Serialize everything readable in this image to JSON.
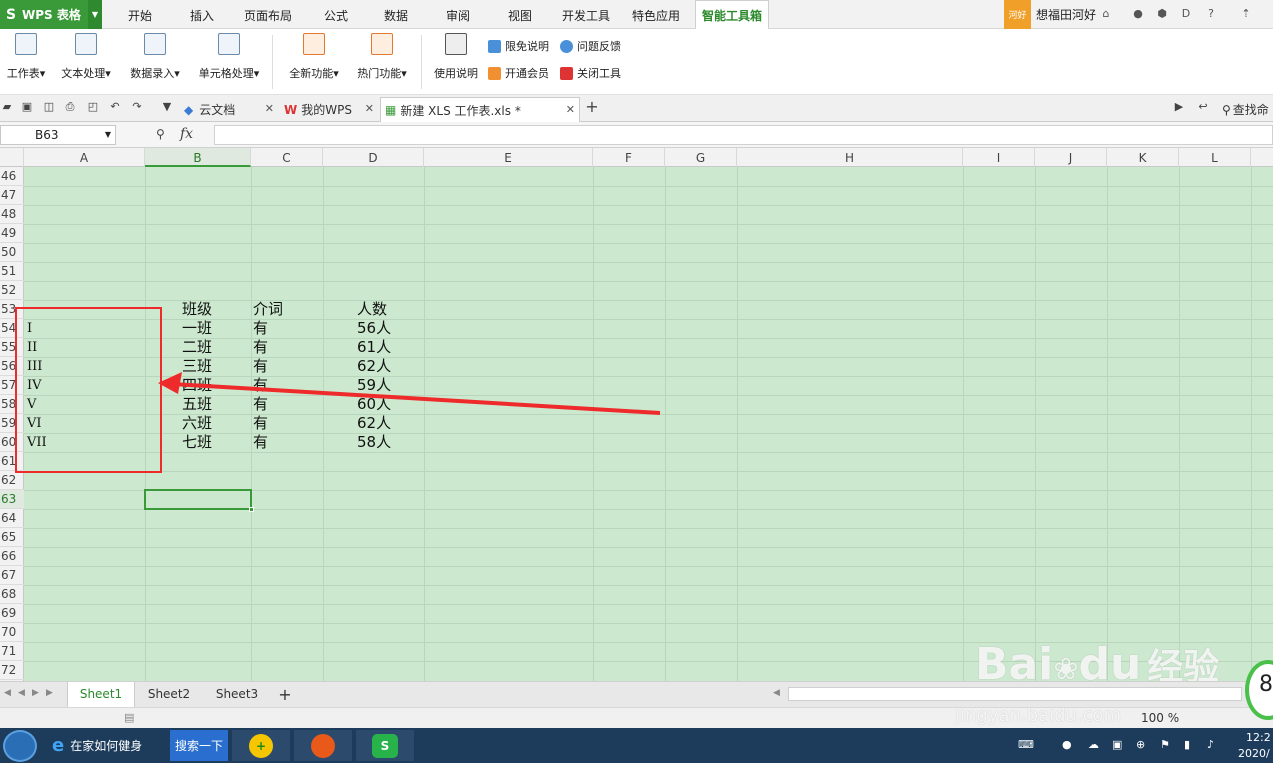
{
  "app": {
    "title": "WPS 表格"
  },
  "menu_tabs": [
    "开始",
    "插入",
    "页面布局",
    "公式",
    "数据",
    "审阅",
    "视图",
    "开发工具",
    "特色应用",
    "智能工具箱"
  ],
  "user": {
    "avatar": "河好",
    "name": "想福田河好"
  },
  "ribbon": {
    "groups": [
      "工作表",
      "文本处理",
      "数据录入",
      "单元格处理",
      "全新功能",
      "热门功能",
      "使用说明"
    ],
    "small": [
      "限免说明",
      "问题反馈",
      "开通会员",
      "关闭工具"
    ]
  },
  "doc_tabs": [
    "云文档",
    "我的WPS",
    "新建 XLS 工作表.xls *"
  ],
  "search_label": "查找命",
  "formula_bar": {
    "name_box": "B63",
    "fx": "fx",
    "content": ""
  },
  "columns": [
    "A",
    "B",
    "C",
    "D",
    "E",
    "F",
    "G",
    "H",
    "I",
    "J",
    "K",
    "L"
  ],
  "rows": [
    "46",
    "47",
    "48",
    "49",
    "50",
    "51",
    "52",
    "53",
    "54",
    "55",
    "56",
    "57",
    "58",
    "59",
    "60",
    "61",
    "62",
    "63",
    "64",
    "65",
    "66",
    "67",
    "68",
    "69",
    "70",
    "71",
    "72"
  ],
  "cells": {
    "A": [
      "I",
      "II",
      "III",
      "IV",
      "V",
      "VI",
      "VII"
    ],
    "B": [
      "班级",
      "一班",
      "二班",
      "三班",
      "四班",
      "五班",
      "六班",
      "七班"
    ],
    "C": [
      "介词",
      "有",
      "有",
      "有",
      "有",
      "有",
      "有",
      "有"
    ],
    "D": [
      "人数",
      "56人",
      "61人",
      "62人",
      "59人",
      "60人",
      "62人",
      "58人"
    ]
  },
  "sheets": [
    "Sheet1",
    "Sheet2",
    "Sheet3"
  ],
  "status": {
    "zoom": "100 %"
  },
  "taskbar": {
    "ie_label": "在家如何健身",
    "search_btn": "搜索一下",
    "clock": "12:2",
    "date": "2020/"
  },
  "watermark": {
    "brand": "Bai",
    "brand2": "du",
    "cn": "经验",
    "url": "jingyan.baidu.com"
  },
  "badge": "8",
  "colors": {
    "accent": "#3a9a3a",
    "grid_bg": "#cce8cf",
    "annotation": "#ee2a2a"
  }
}
